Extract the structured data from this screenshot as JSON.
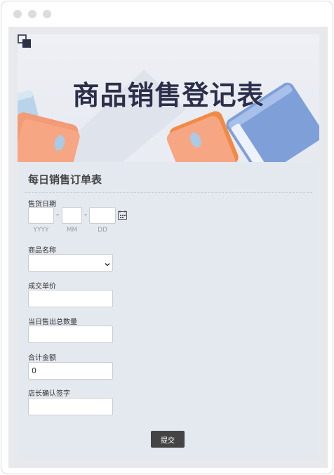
{
  "window": {
    "traffic_lights": [
      "dot-1",
      "dot-2",
      "dot-3"
    ]
  },
  "banner": {
    "title": "商品销售登记表",
    "copy_icon": "copy-icon"
  },
  "form": {
    "heading": "每日销售订单表",
    "date": {
      "label": "售货日期",
      "separator": "-",
      "year_hint": "YYYY",
      "month_hint": "MM",
      "day_hint": "DD",
      "year_value": "",
      "month_value": "",
      "day_value": "",
      "icon": "calendar-icon"
    },
    "product": {
      "label": "商品名称",
      "selected": ""
    },
    "unit_price": {
      "label": "成交单价",
      "value": ""
    },
    "total_quantity": {
      "label": "当日售出总数量",
      "value": ""
    },
    "total_amount": {
      "label": "合计金额",
      "value": "0"
    },
    "manager_signature": {
      "label": "店长确认签字",
      "value": ""
    },
    "submit_label": "提交"
  },
  "colors": {
    "page_bg": "#e4e8ef",
    "title_color": "#2c2f4a",
    "button_bg": "#444444",
    "accent_orange": "#f7a684",
    "accent_blue": "#7e9fd8"
  }
}
